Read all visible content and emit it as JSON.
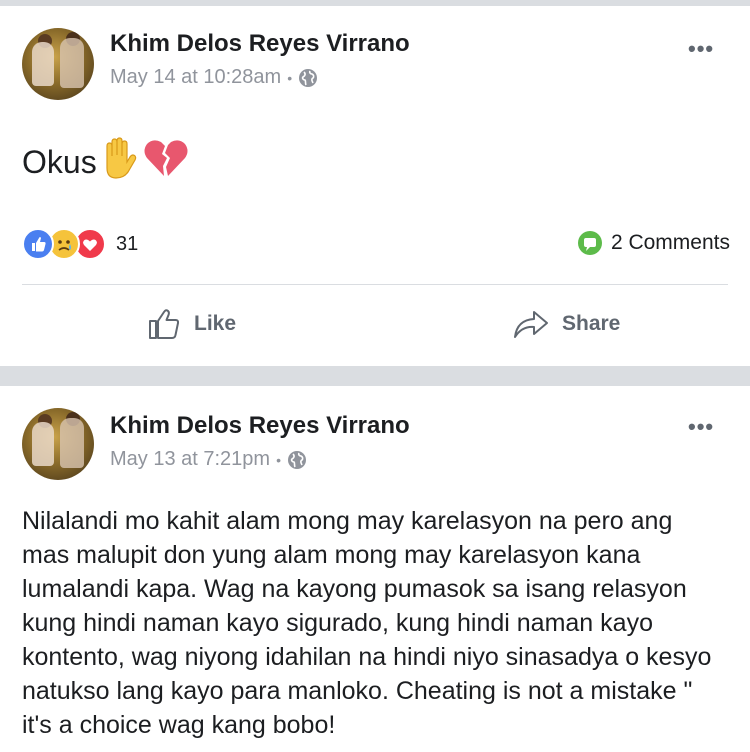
{
  "posts": [
    {
      "author": "Khim Delos Reyes Virrano",
      "timestamp": "May 14 at 10:28am",
      "privacy_icon": "globe-icon",
      "text": "Okus",
      "emoji": [
        "raised-hand-emoji",
        "broken-heart-emoji"
      ],
      "reactions": {
        "types": [
          "like",
          "sad",
          "love"
        ],
        "count": "31"
      },
      "comments": "2 Comments",
      "actions": {
        "like": "Like",
        "share": "Share"
      }
    },
    {
      "author": "Khim Delos Reyes Virrano",
      "timestamp": "May 13 at 7:21pm",
      "privacy_icon": "globe-icon",
      "lines": [
        "Nilalandi mo kahit alam mong may karelasyon na pero ang",
        "mas malupit don yung alam mong may karelasyon kana",
        "lumalandi kapa. Wag na kayong pumasok sa isang relasyon",
        "kung hindi naman kayo sigurado, kung hindi naman kayo",
        "kontento, wag niyong idahilan na hindi niyo sinasadya o kesyo",
        "natukso lang kayo para manloko. Cheating is not a mistake \"",
        "it's a choice wag kang bobo!"
      ]
    }
  ],
  "more_label": "•••",
  "dot": "•",
  "colors": {
    "like_blue": "#4a7ff0",
    "love_red": "#f03a4b",
    "sad_yellow": "#f5c33b",
    "comment_green": "#5dbb4a",
    "meta_gray": "#90949c"
  }
}
